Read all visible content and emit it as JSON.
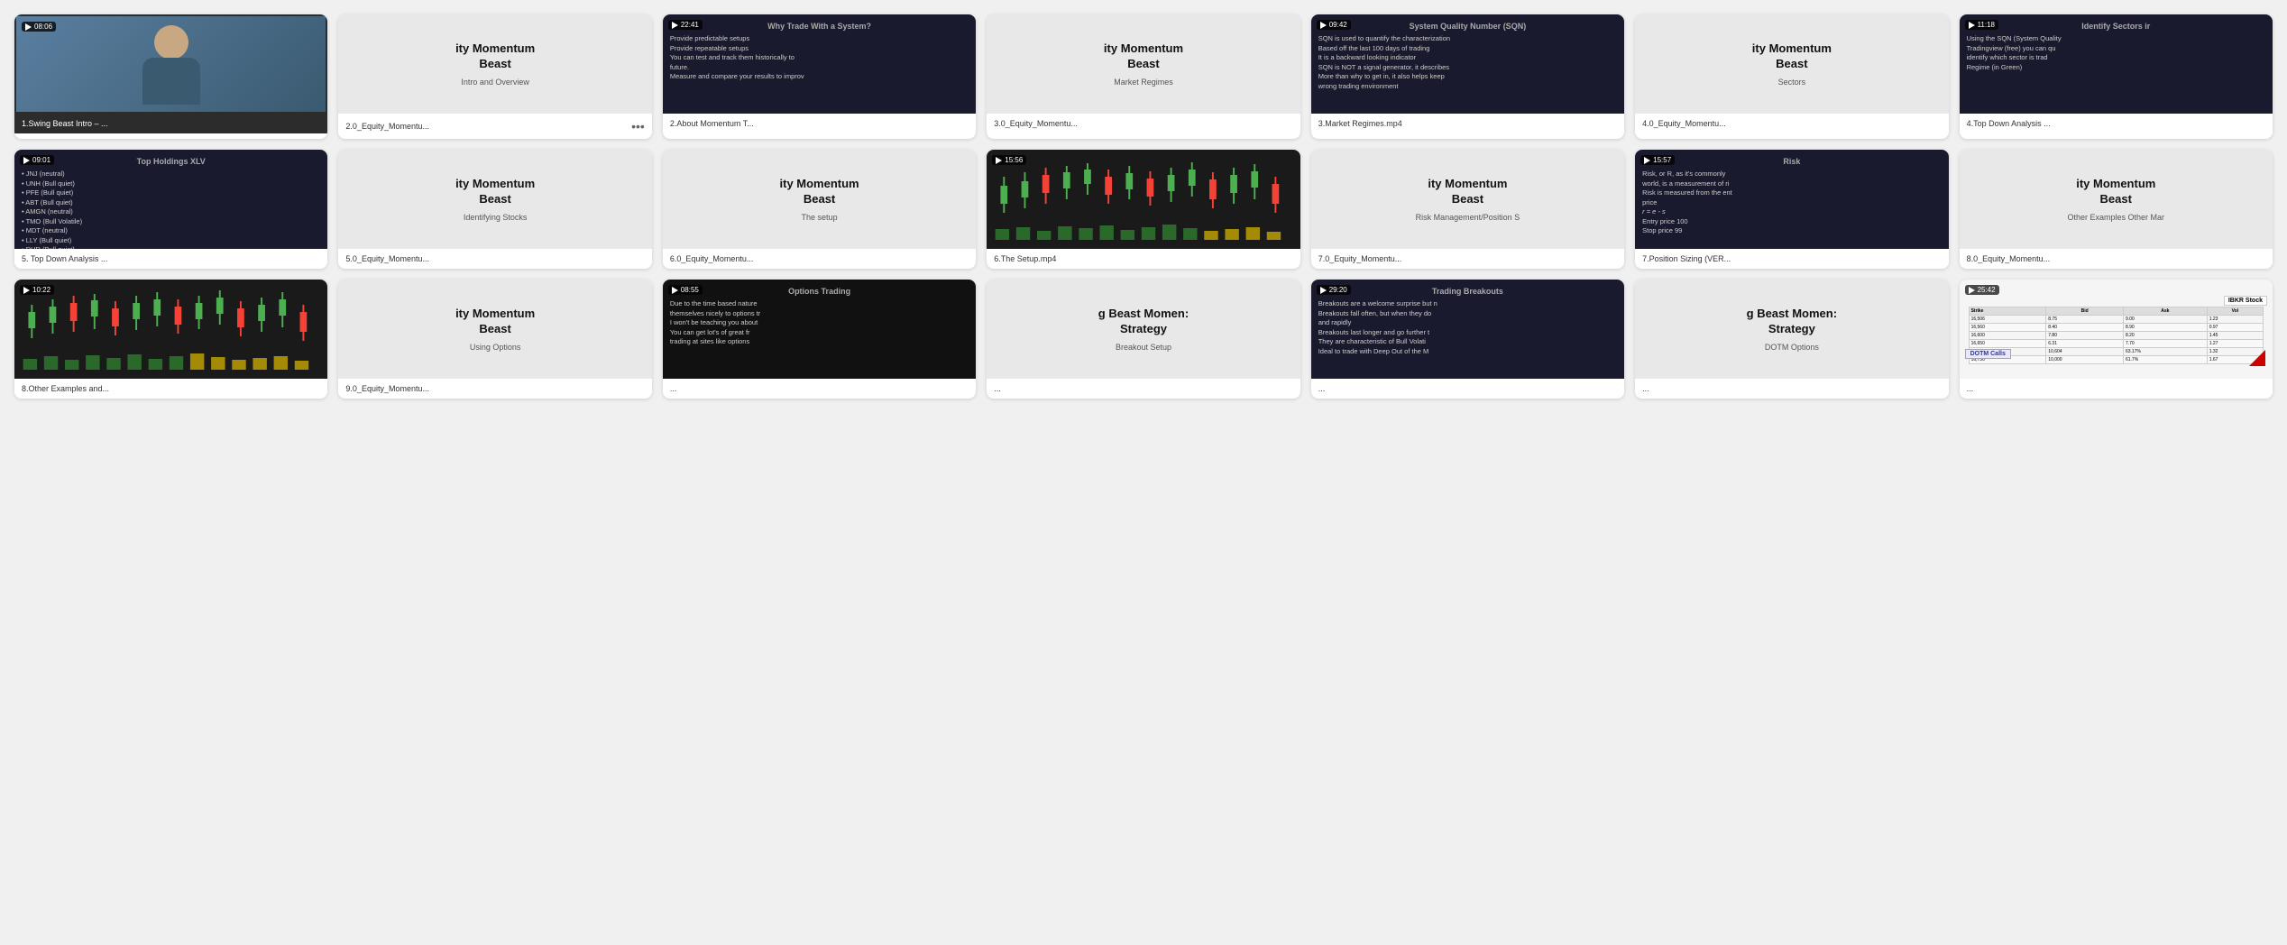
{
  "cards": [
    {
      "id": "card-1",
      "type": "video-person",
      "duration": "08:06",
      "label": "1.Swing Beast Intro – ...",
      "has_dots": false,
      "is_active": true,
      "thumb_bg": "#4a6e8c"
    },
    {
      "id": "card-2",
      "type": "momentum",
      "duration": null,
      "title": "ity Momentum\nBeast",
      "subtitle": "Intro and Overview",
      "label": "2.0_Equity_Momentu...",
      "has_dots": true,
      "is_active": false
    },
    {
      "id": "card-3",
      "type": "text-slide",
      "duration": "22:41",
      "label": "2.About Momentum T...",
      "has_dots": false,
      "is_active": false,
      "thumb_title": "Why Trade With a System?",
      "thumb_lines": [
        "Provide predictable setups",
        "Provide repeatable setups",
        "You can test and track them historically to",
        "future.",
        "Measure and compare your results to improv"
      ]
    },
    {
      "id": "card-4",
      "type": "momentum",
      "duration": null,
      "title": "ity Momentum\nBeast",
      "subtitle": "Market Regimes",
      "label": "3.0_Equity_Momentu...",
      "has_dots": false,
      "is_active": false
    },
    {
      "id": "card-5",
      "type": "text-slide",
      "duration": "09:42",
      "label": "3.Market Regimes.mp4",
      "has_dots": false,
      "is_active": false,
      "thumb_title": "System Quality Number (SQN)",
      "thumb_lines": [
        "SQN is used to quantify the characterization",
        "Based off the last 100 days of trading",
        "It is a backward looking indicator",
        "SQN is NOT a signal generator, it describe:",
        "More than why to get in, it also helps keej",
        "wrong trading environment"
      ]
    },
    {
      "id": "card-6",
      "type": "momentum",
      "duration": null,
      "title": "ity Momentum\nBeast",
      "subtitle": "Sectors",
      "label": "4.0_Equity_Momentu...",
      "has_dots": false,
      "is_active": false
    },
    {
      "id": "card-7",
      "type": "text-slide",
      "duration": "11:18",
      "label": "4.Top Down Analysis ...",
      "has_dots": false,
      "is_active": false,
      "thumb_title": "Identify Sectors ir",
      "thumb_lines": [
        "Using the SQN (System Quality",
        "Tradingview (free) you can qu",
        "identify which sector is trad",
        "Regime (in Green)"
      ]
    },
    {
      "id": "card-8",
      "type": "text-slide-bullets",
      "duration": "09:01",
      "label": "5. Top Down Analysis ...",
      "has_dots": false,
      "is_active": false,
      "thumb_title": "Top Holdings XLV",
      "thumb_bullets": [
        "JNJ (neutral)",
        "UNH (Bull quiet)",
        "PFE (Bull quiet)",
        "ABT (Bull quiet)",
        "AMGN (neutral)",
        "TMO (Bull Volatile)",
        "MDT (neutral)",
        "LLY (Bull quiet)",
        "DHR (Bull quiet)"
      ]
    },
    {
      "id": "card-9",
      "type": "momentum",
      "duration": null,
      "title": "ity Momentum\nBeast",
      "subtitle": "Identifying Stocks",
      "label": "5.0_Equity_Momentu...",
      "has_dots": false,
      "is_active": false
    },
    {
      "id": "card-10",
      "type": "momentum",
      "duration": null,
      "title": "ity Momentum\nBeast",
      "subtitle": "The setup",
      "label": "6.0_Equity_Momentu...",
      "has_dots": false,
      "is_active": false
    },
    {
      "id": "card-11",
      "type": "chart",
      "duration": "15:56",
      "label": "6.The Setup.mp4",
      "has_dots": false,
      "is_active": false
    },
    {
      "id": "card-12",
      "type": "momentum",
      "duration": null,
      "title": "ity Momentum\nBeast",
      "subtitle": "Risk Management/Position S",
      "label": "7.0_Equity_Momentu...",
      "has_dots": false,
      "is_active": false
    },
    {
      "id": "card-13",
      "type": "text-slide",
      "duration": "15:57",
      "label": "7.Position Sizing (VER...",
      "has_dots": false,
      "is_active": false,
      "thumb_title": "Risk",
      "thumb_lines": [
        "Risk, or R, as it's commonly",
        "world, is a measurement of ri",
        "Risk is measured from the ent",
        "price",
        "r = e - s",
        "Entry price 100",
        "Stop price 99"
      ]
    },
    {
      "id": "card-14",
      "type": "momentum",
      "duration": null,
      "title": "ity Momentum\nBeast",
      "subtitle": "Other Examples Other Mar",
      "label": "8.0_Equity_Momentu...",
      "has_dots": false,
      "is_active": false
    },
    {
      "id": "card-15",
      "type": "chart",
      "duration": "10:22",
      "label": "8.Other Examples and...",
      "has_dots": false,
      "is_active": false
    },
    {
      "id": "card-16",
      "type": "momentum",
      "duration": null,
      "title": "ity Momentum\nBeast",
      "subtitle": "Using Options",
      "label": "9.0_Equity_Momentu...",
      "has_dots": false,
      "is_active": false
    },
    {
      "id": "card-17",
      "type": "text-slide",
      "duration": "08:55",
      "label": "...",
      "has_dots": false,
      "is_active": false,
      "thumb_title": "Options Trading",
      "thumb_lines": [
        "Due to the time based nature",
        "themselves nicely to options tr",
        "I won't be teaching you about",
        "You can get lot's of great fr",
        "trading at sites like options"
      ]
    },
    {
      "id": "card-18",
      "type": "momentum-strategy",
      "duration": null,
      "title": "g Beast Momen:\nStrategy",
      "subtitle": "Breakout Setup",
      "label": "...",
      "has_dots": false,
      "is_active": false
    },
    {
      "id": "card-19",
      "type": "text-slide",
      "duration": "29:20",
      "label": "...",
      "has_dots": false,
      "is_active": false,
      "thumb_title": "Trading Breakouts",
      "thumb_lines": [
        "Breakouts are a welcome surprise but n",
        "Breakouts fall often, but when they do",
        "and rapidly",
        "Breakouts last longer and go further t",
        "They are characteristic of Bull Volati",
        "Ideal to trade with Deep Out of the M"
      ]
    },
    {
      "id": "card-20",
      "type": "momentum-strategy",
      "duration": null,
      "title": "g Beast Momen:\nStrategy",
      "subtitle": "DOTM Options",
      "label": "...",
      "has_dots": false,
      "is_active": false
    },
    {
      "id": "card-21",
      "type": "screenshot",
      "duration": "25:42",
      "label": "...",
      "has_dots": false,
      "is_active": false
    }
  ]
}
